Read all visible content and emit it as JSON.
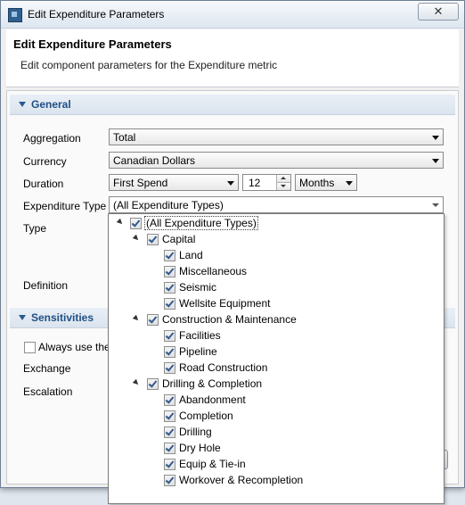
{
  "window": {
    "title": "Edit Expenditure Parameters",
    "close_glyph": "✕"
  },
  "header": {
    "title": "Edit Expenditure Parameters",
    "subtitle": "Edit component parameters for the Expenditure metric"
  },
  "general": {
    "label": "General",
    "aggregation": {
      "label": "Aggregation",
      "value": "Total"
    },
    "currency": {
      "label": "Currency",
      "value": "Canadian Dollars"
    },
    "duration": {
      "label": "Duration",
      "start": "First Spend",
      "number": "12",
      "unit": "Months"
    },
    "expenditure_type": {
      "label": "Expenditure Type",
      "value": "(All Expenditure Types)"
    },
    "type_label": "Type",
    "definition_label": "Definition"
  },
  "sensitivities": {
    "label": "Sensitivities",
    "always_use": "Always use the",
    "exchange_label": "Exchange",
    "escalation_label": "Escalation"
  },
  "tree": [
    {
      "label": "(All Expenditure Types)",
      "level": 0,
      "expander": true,
      "checked": true
    },
    {
      "label": "Capital",
      "level": 1,
      "expander": true,
      "checked": true
    },
    {
      "label": "Land",
      "level": 2,
      "expander": false,
      "checked": true
    },
    {
      "label": "Miscellaneous",
      "level": 2,
      "expander": false,
      "checked": true
    },
    {
      "label": "Seismic",
      "level": 2,
      "expander": false,
      "checked": true
    },
    {
      "label": "Wellsite Equipment",
      "level": 2,
      "expander": false,
      "checked": true
    },
    {
      "label": "Construction & Maintenance",
      "level": 1,
      "expander": true,
      "checked": true
    },
    {
      "label": "Facilities",
      "level": 2,
      "expander": false,
      "checked": true
    },
    {
      "label": "Pipeline",
      "level": 2,
      "expander": false,
      "checked": true
    },
    {
      "label": "Road Construction",
      "level": 2,
      "expander": false,
      "checked": true
    },
    {
      "label": "Drilling & Completion",
      "level": 1,
      "expander": true,
      "checked": true
    },
    {
      "label": "Abandonment",
      "level": 2,
      "expander": false,
      "checked": true
    },
    {
      "label": "Completion",
      "level": 2,
      "expander": false,
      "checked": true
    },
    {
      "label": "Drilling",
      "level": 2,
      "expander": false,
      "checked": true
    },
    {
      "label": "Dry Hole",
      "level": 2,
      "expander": false,
      "checked": true
    },
    {
      "label": "Equip & Tie-in",
      "level": 2,
      "expander": false,
      "checked": true
    },
    {
      "label": "Workover & Recompletion",
      "level": 2,
      "expander": false,
      "checked": true
    }
  ]
}
